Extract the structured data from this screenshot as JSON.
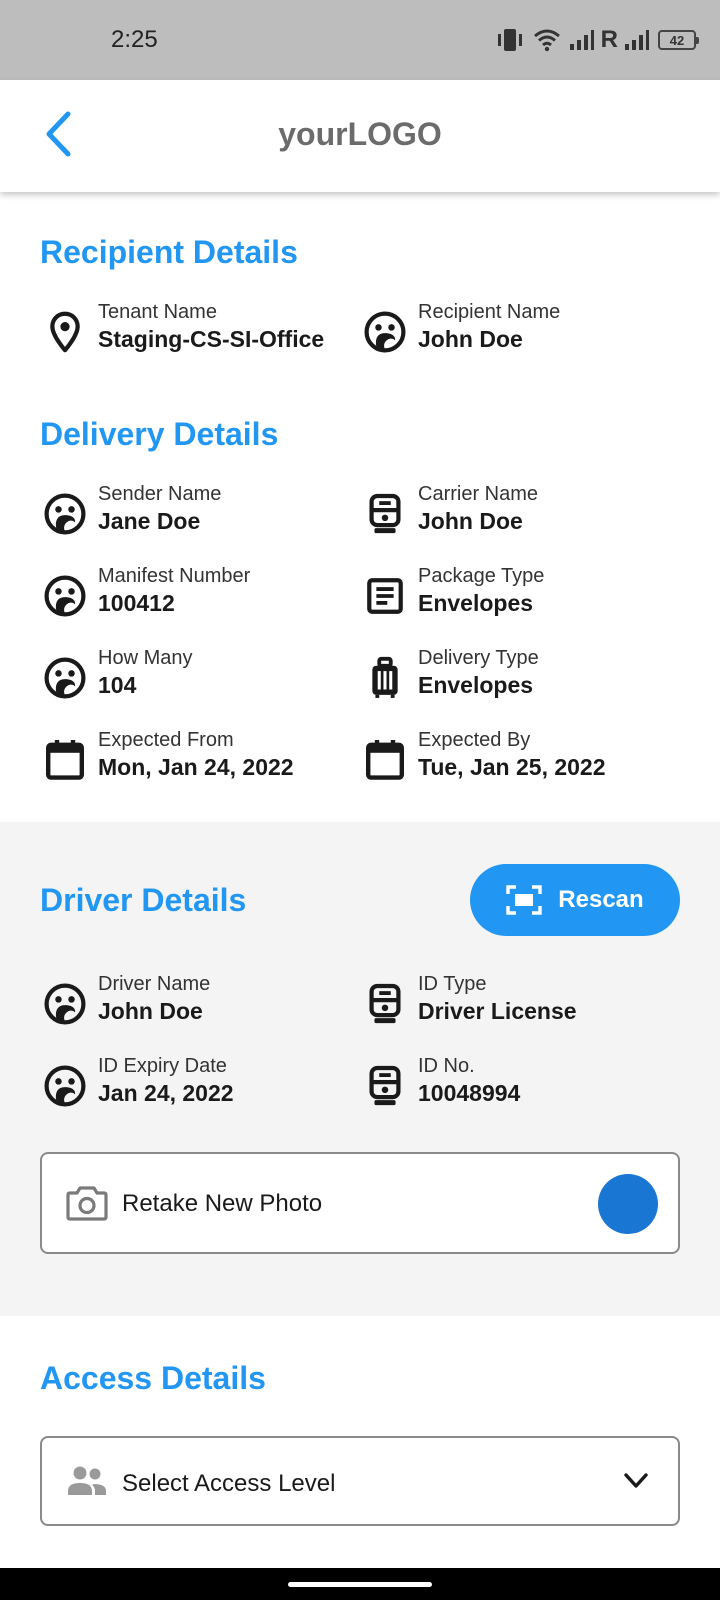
{
  "status_bar": {
    "time": "2:25",
    "network_letter": "R",
    "battery": "42"
  },
  "header": {
    "title": "yourLOGO"
  },
  "recipient": {
    "title": "Recipient Details",
    "tenant": {
      "label": "Tenant Name",
      "value": "Staging-CS-SI-Office",
      "icon": "location-pin-icon"
    },
    "recipient_name": {
      "label": "Recipient Name",
      "value": "John Doe",
      "icon": "face-icon"
    }
  },
  "delivery": {
    "title": "Delivery Details",
    "sender": {
      "label": "Sender Name",
      "value": "Jane Doe",
      "icon": "face-icon"
    },
    "carrier": {
      "label": "Carrier Name",
      "value": "John Doe",
      "icon": "train-icon"
    },
    "manifest": {
      "label": "Manifest Number",
      "value": "100412",
      "icon": "face-icon"
    },
    "package_type": {
      "label": "Package Type",
      "value": "Envelopes",
      "icon": "document-icon"
    },
    "how_many": {
      "label": "How Many",
      "value": "104",
      "icon": "face-icon"
    },
    "delivery_type": {
      "label": "Delivery Type",
      "value": "Envelopes",
      "icon": "luggage-icon"
    },
    "expected_from": {
      "label": "Expected From",
      "value": "Mon, Jan 24, 2022",
      "icon": "calendar-icon"
    },
    "expected_by": {
      "label": "Expected By",
      "value": "Tue, Jan 25, 2022",
      "icon": "calendar-icon"
    }
  },
  "driver": {
    "title": "Driver Details",
    "rescan_label": "Rescan",
    "driver_name": {
      "label": "Driver Name",
      "value": "John Doe",
      "icon": "face-icon"
    },
    "id_type": {
      "label": "ID Type",
      "value": "Driver License",
      "icon": "train-icon"
    },
    "id_expiry": {
      "label": "ID Expiry Date",
      "value": "Jan 24, 2022",
      "icon": "face-icon"
    },
    "id_no": {
      "label": "ID No.",
      "value": "10048994",
      "icon": "train-icon"
    },
    "photo_label": "Retake New Photo"
  },
  "access": {
    "title": "Access Details",
    "select_placeholder": "Select Access Level"
  },
  "colors": {
    "accent": "#2196f3",
    "button_dot": "#1976d2",
    "gray_section": "#f4f4f4"
  }
}
